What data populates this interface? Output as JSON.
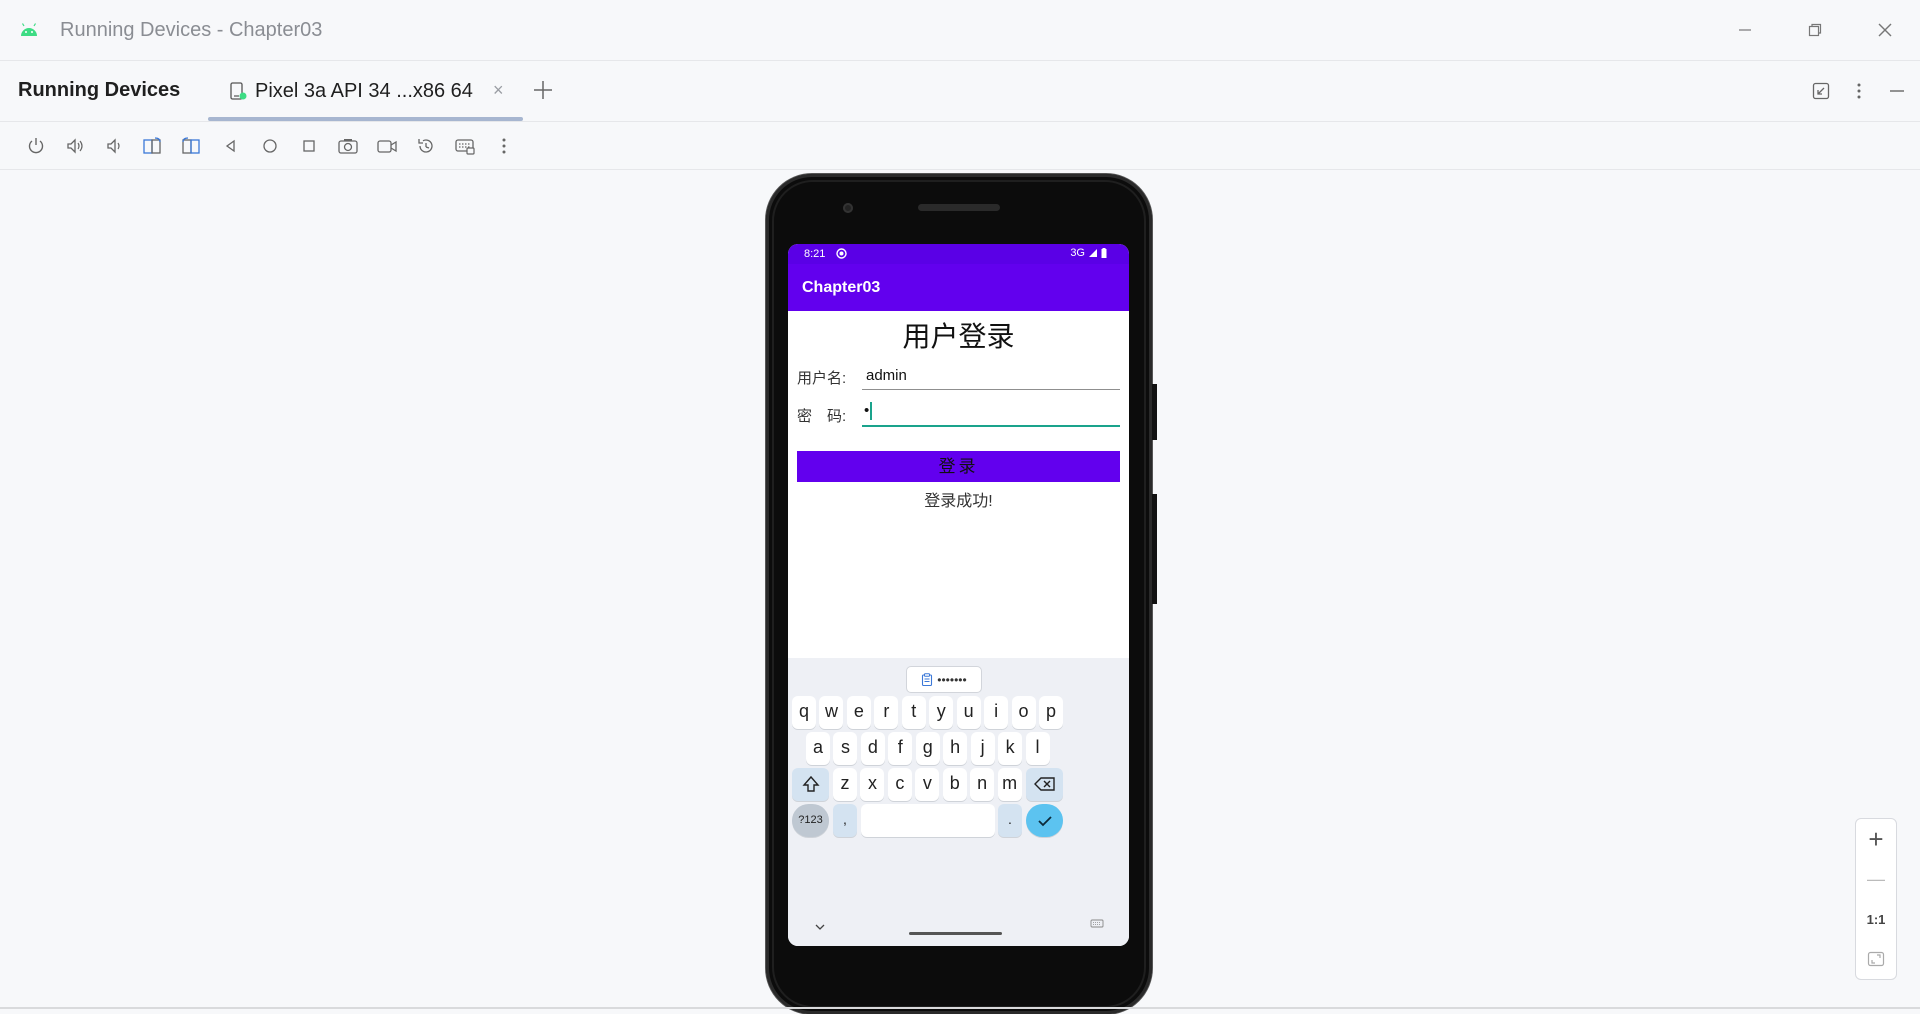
{
  "window": {
    "title": "Running Devices - Chapter03",
    "app_icon": "android-icon",
    "accent": "#3ddc84"
  },
  "tool_window": {
    "title": "Running Devices",
    "tab_label": "Pixel 3a API 34 ...x86 64",
    "tab_close": "×"
  },
  "toolbar_icons": [
    "power-icon",
    "volume-up-icon",
    "volume-down-icon",
    "rotate-left-icon",
    "rotate-right-icon",
    "back-icon",
    "home-icon",
    "overview-icon",
    "screenshot-icon",
    "screen-record-icon",
    "reset-icon",
    "keyboard-icon",
    "more-icon"
  ],
  "device": {
    "status": {
      "time": "8:21",
      "network": "3G"
    },
    "app_title": "Chapter03",
    "screen_title": "用户登录",
    "username_label": "用户名:",
    "username_value": "admin",
    "password_label": "密　码:",
    "password_value": "•",
    "login_button": "登录",
    "result_text": "登录成功!",
    "colors": {
      "status_bar": "#5a00e6",
      "app_bar": "#6200ee",
      "focus_line": "#1aa38c"
    }
  },
  "keyboard": {
    "suggestion": "•••••••",
    "row1": [
      "q",
      "w",
      "e",
      "r",
      "t",
      "y",
      "u",
      "i",
      "o",
      "p"
    ],
    "row2": [
      "a",
      "s",
      "d",
      "f",
      "g",
      "h",
      "j",
      "k",
      "l"
    ],
    "row3": [
      "z",
      "x",
      "c",
      "v",
      "b",
      "n",
      "m"
    ],
    "sym_key": "?123",
    "comma_key": ",",
    "period_key": "."
  },
  "zoom": {
    "zoom_in": "+",
    "zoom_out": "—",
    "actual_size": "1:1"
  }
}
